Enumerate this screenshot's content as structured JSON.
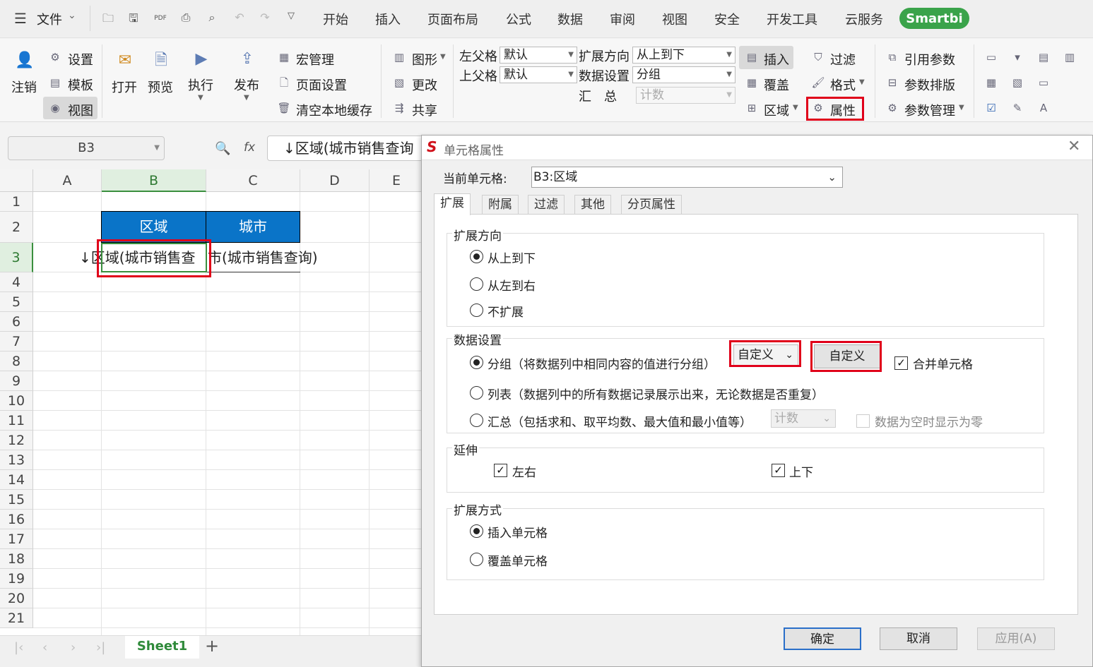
{
  "menubar": {
    "file_label": "文件",
    "tabs": [
      "开始",
      "插入",
      "页面布局",
      "公式",
      "数据",
      "审阅",
      "视图",
      "安全",
      "开发工具",
      "云服务"
    ],
    "smartbi": "Smartbi"
  },
  "ribbon": {
    "logout": "注销",
    "settings": "设置",
    "template": "模板",
    "view": "视图",
    "open": "打开",
    "preview": "预览",
    "execute": "执行",
    "publish": "发布",
    "macro": "宏管理",
    "page_setup": "页面设置",
    "clear_cache": "清空本地缓存",
    "chart": "图形",
    "change": "更改",
    "share": "共享",
    "left_parent_label": "左父格",
    "left_parent_value": "默认",
    "top_parent_label": "上父格",
    "top_parent_value": "默认",
    "expand_dir_label": "扩展方向",
    "expand_dir_value": "从上到下",
    "data_setting_label": "数据设置",
    "data_setting_value": "分组",
    "summary_label": "汇　总",
    "summary_value": "计数",
    "insert": "插入",
    "cover": "覆盖",
    "region": "区域",
    "filter": "过滤",
    "format": "格式",
    "property": "属性",
    "ref_param": "引用参数",
    "param_layout": "参数排版",
    "param_manage": "参数管理"
  },
  "formula": {
    "namebox": "B3",
    "fx": "fx",
    "content": "↓区域(城市销售查询"
  },
  "grid": {
    "columns": [
      "A",
      "B",
      "C",
      "D",
      "E"
    ],
    "rows": [
      "1",
      "2",
      "3",
      "4",
      "5",
      "6",
      "7",
      "8",
      "9",
      "10",
      "11",
      "12",
      "13",
      "14",
      "15",
      "16",
      "17",
      "18",
      "19",
      "20",
      "21"
    ],
    "header_b2": "区域",
    "header_c2": "城市",
    "cell_b3": "↓区域(城市销售查",
    "cell_c3": "市(城市销售查询)"
  },
  "sheetbar": {
    "sheet_name": "Sheet1",
    "add": "+"
  },
  "dialog": {
    "title": "单元格属性",
    "current_cell_label": "当前单元格:",
    "current_cell_value": "B3:区域",
    "tabs": [
      "扩展",
      "附属",
      "过滤",
      "其他",
      "分页属性"
    ],
    "expand_dir_title": "扩展方向",
    "dir_options": [
      "从上到下",
      "从左到右",
      "不扩展"
    ],
    "data_setting_title": "数据设置",
    "group_label": "分组（将数据列中相同内容的值进行分组）",
    "group_select": "自定义",
    "custom_button": "自定义",
    "merge_cells": "合并单元格",
    "list_label": "列表（数据列中的所有数据记录展示出来，无论数据是否重复）",
    "summary_label": "汇总（包括求和、取平均数、最大值和最小值等）",
    "summary_select": "计数",
    "empty_zero": "数据为空时显示为零",
    "extend_title": "延伸",
    "lr": "左右",
    "ud": "上下",
    "expand_mode_title": "扩展方式",
    "mode_options": [
      "插入单元格",
      "覆盖单元格"
    ],
    "ok": "确定",
    "cancel": "取消",
    "apply": "应用(A)"
  }
}
